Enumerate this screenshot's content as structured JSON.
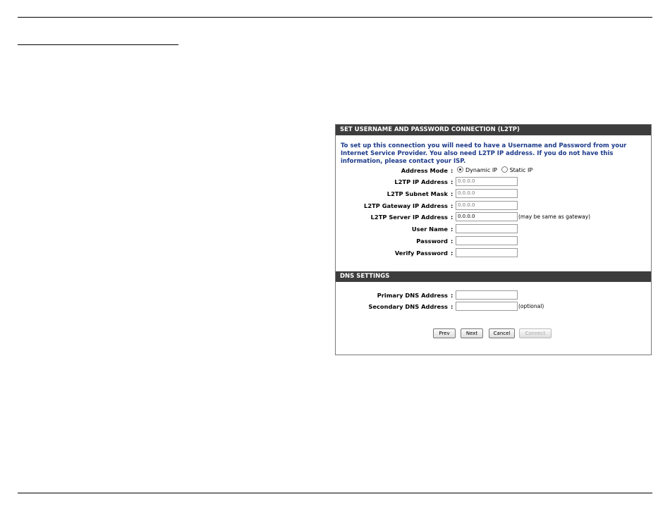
{
  "l2tp": {
    "header": "SET USERNAME AND PASSWORD CONNECTION (L2TP)",
    "intro": "To set up this connection you will need to have a Username and Password from your Internet Service Provider. You also need L2TP IP address. If you do not have this information, please contact your ISP.",
    "address_mode_label": "Address Mode",
    "dynamic_ip_label": "Dynamic IP",
    "static_ip_label": "Static IP",
    "selected_mode": "Dynamic IP",
    "ip_address_label": "L2TP IP Address",
    "ip_address_value": "0.0.0.0",
    "subnet_mask_label": "L2TP Subnet Mask",
    "subnet_mask_value": "0.0.0.0",
    "gateway_label": "L2TP Gateway IP Address",
    "gateway_value": "0.0.0.0",
    "server_label": "L2TP Server IP Address",
    "server_value": "0.0.0.0",
    "server_note": "(may be same as gateway)",
    "username_label": "User Name",
    "username_value": "",
    "password_label": "Password",
    "password_value": "",
    "verify_password_label": "Verify Password",
    "verify_password_value": ""
  },
  "dns": {
    "header": "DNS SETTINGS",
    "primary_label": "Primary DNS Address",
    "primary_value": "",
    "secondary_label": "Secondary DNS Address",
    "secondary_value": "",
    "secondary_note": "(optional)"
  },
  "buttons": {
    "prev": "Prev",
    "next": "Next",
    "cancel": "Cancel",
    "connect": "Connect"
  },
  "colon": ":"
}
